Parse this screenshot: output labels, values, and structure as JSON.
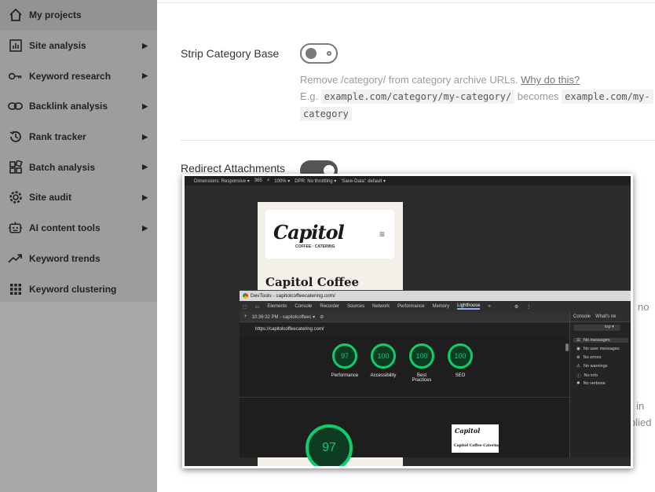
{
  "sidebar": {
    "items": [
      {
        "label": "My projects",
        "icon": "home-icon",
        "has_arrow": false
      },
      {
        "label": "Site analysis",
        "icon": "chart-icon",
        "has_arrow": true
      },
      {
        "label": "Keyword research",
        "icon": "key-icon",
        "has_arrow": true
      },
      {
        "label": "Backlink analysis",
        "icon": "link-icon",
        "has_arrow": true
      },
      {
        "label": "Rank tracker",
        "icon": "history-icon",
        "has_arrow": true
      },
      {
        "label": "Batch analysis",
        "icon": "blocks-icon",
        "has_arrow": true
      },
      {
        "label": "Site audit",
        "icon": "gear-icon",
        "has_arrow": true
      },
      {
        "label": "AI content tools",
        "icon": "robot-icon",
        "has_arrow": true
      },
      {
        "label": "Keyword trends",
        "icon": "trend-icon",
        "has_arrow": false
      },
      {
        "label": "Keyword clustering",
        "icon": "grid-icon",
        "has_arrow": false
      }
    ]
  },
  "settings": {
    "strip_category": {
      "title": "Strip Category Base",
      "desc_prefix": "Remove /category/ from category archive URLs.",
      "why_link": "Why do this?",
      "eg_prefix": "E.g.",
      "code_from": "example.com/category/my-category/",
      "becomes": "becomes",
      "code_to_part1": "example.com/my-",
      "code_to_part2": "category"
    },
    "redirect_attachments": {
      "title": "Redirect Attachments"
    },
    "frag_no": "no",
    "frag_ng": "ng in",
    "frag_plied": "plied"
  },
  "screenshot": {
    "responsive_bar": {
      "dimensions_label": "Dimensions: Responsive ▾",
      "width": "365",
      "x": "×",
      "zoom": "100% ▾",
      "dpr": "DPR: No throttling ▾",
      "save_data": "'Save-Data': default ▾"
    },
    "phone": {
      "logo": "Capitol",
      "logo_sub": "COFFEE · CATERING",
      "title": "Capitol Coffee"
    },
    "devtools": {
      "title": "DevTools - capitolcoffeecatering.com/",
      "tabs": [
        "Elements",
        "Console",
        "Recorder",
        "Sources",
        "Network",
        "Performance",
        "Memory",
        "Lighthouse",
        "»"
      ],
      "active_tab": "Lighthouse",
      "sub_time": "10:36:32 PM - capitolcoffeec ▾",
      "url": "https://capitolcoffeecatering.com/",
      "scores": [
        {
          "value": "97",
          "label": "Performance"
        },
        {
          "value": "100",
          "label": "Accessibility"
        },
        {
          "value": "100",
          "label": "Best Practices"
        },
        {
          "value": "100",
          "label": "SEO"
        }
      ],
      "big_score": "97",
      "thumb_logo": "Capitol",
      "thumb_title": "Capitol Coffee Catering",
      "console": {
        "tab_console": "Console",
        "tab_whats_new": "What's ne",
        "top": "top ▾",
        "items": [
          "No messages",
          "No user messages",
          "No errors",
          "No warnings",
          "No info",
          "No verbose"
        ]
      }
    }
  }
}
